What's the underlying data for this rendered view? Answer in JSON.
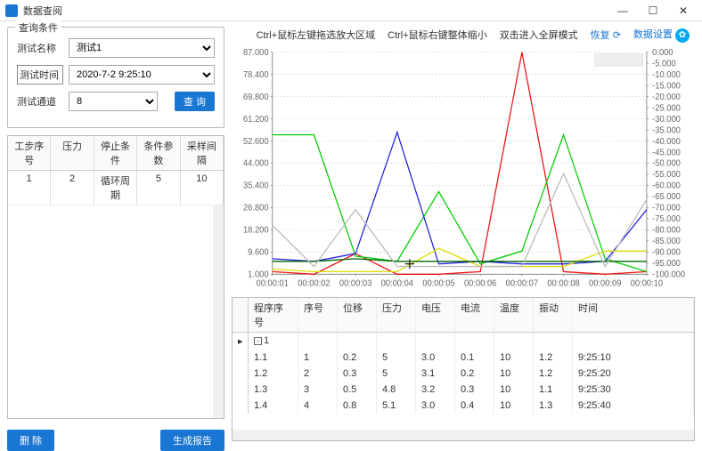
{
  "window": {
    "title": "数据查阅"
  },
  "query_panel": {
    "title": "查询条件",
    "test_name_label": "测试名称",
    "test_name_value": "测试1",
    "test_time_label": "测试时间",
    "test_time_value": "2020-7-2 9:25:10",
    "test_channel_label": "测试通道",
    "test_channel_value": "8",
    "query_btn": "查 询"
  },
  "step_table": {
    "headers": [
      "工步序号",
      "压力",
      "停止条件",
      "条件参数",
      "采样间隔"
    ],
    "row": [
      "1",
      "2",
      "循环周期",
      "5",
      "10"
    ]
  },
  "left_actions": {
    "delete": "删 除",
    "report": "生成报告"
  },
  "hints": {
    "h1": "Ctrl+鼠标左键拖选放大区域",
    "h2": "Ctrl+鼠标右键整体缩小",
    "h3": "双击进入全屏模式",
    "restore": "恢复",
    "settings": "数据设置"
  },
  "chart_data": {
    "type": "line",
    "x_categories": [
      "00:00:01",
      "00:00:02",
      "00:00:03",
      "00:00:04",
      "00:00:05",
      "00:00:06",
      "00:00:07",
      "00:00:08",
      "00:00:09",
      "00:00:10"
    ],
    "y_left_ticks": [
      1.0,
      9.6,
      18.2,
      26.8,
      35.4,
      44.0,
      52.6,
      61.2,
      69.8,
      78.4,
      87.0
    ],
    "y_right_ticks": [
      0.0,
      -5.0,
      -10.0,
      -15.0,
      -20.0,
      -25.0,
      -30.0,
      -35.0,
      -40.0,
      -45.0,
      -50.0,
      -55.0,
      -60.0,
      -65.0,
      -70.0,
      -75.0,
      -80.0,
      -85.0,
      -90.0,
      -95.0,
      -100.0
    ],
    "series": [
      {
        "name": "red",
        "color": "#e11",
        "values": [
          2,
          1,
          9,
          1,
          1,
          2,
          87,
          2,
          1,
          2
        ]
      },
      {
        "name": "green-bright",
        "color": "#0c0",
        "values": [
          55,
          55,
          8,
          6,
          33,
          5,
          10,
          55,
          7,
          2
        ]
      },
      {
        "name": "blue",
        "color": "#22d",
        "values": [
          7,
          6,
          9,
          56,
          5,
          6,
          5,
          5,
          6,
          26
        ]
      },
      {
        "name": "yellow",
        "color": "#dd0",
        "values": [
          3,
          2,
          2,
          2,
          11,
          4,
          4,
          4,
          10,
          10
        ]
      },
      {
        "name": "darkgreen",
        "color": "#060",
        "values": [
          6,
          6,
          7,
          6,
          6,
          6,
          6,
          6,
          6,
          6
        ]
      },
      {
        "name": "gray",
        "color": "#bbb",
        "values": [
          20,
          4,
          26,
          4,
          4,
          4,
          4,
          40,
          4,
          30
        ]
      }
    ]
  },
  "data_grid": {
    "headers": [
      "",
      "程序序号",
      "序号",
      "位移",
      "压力",
      "电压",
      "电流",
      "温度",
      "振动",
      "时间"
    ],
    "group_label": "1",
    "rows": [
      [
        "",
        "1.1",
        "1",
        "0.2",
        "5",
        "3.0",
        "0.1",
        "10",
        "1.2",
        "9:25:10"
      ],
      [
        "",
        "1.2",
        "2",
        "0.3",
        "5",
        "3.1",
        "0.2",
        "10",
        "1.2",
        "9:25:20"
      ],
      [
        "",
        "1.3",
        "3",
        "0.5",
        "4.8",
        "3.2",
        "0.3",
        "10",
        "1.1",
        "9:25:30"
      ],
      [
        "",
        "1.4",
        "4",
        "0.8",
        "5.1",
        "3.0",
        "0.4",
        "10",
        "1.3",
        "9:25:40"
      ]
    ]
  }
}
